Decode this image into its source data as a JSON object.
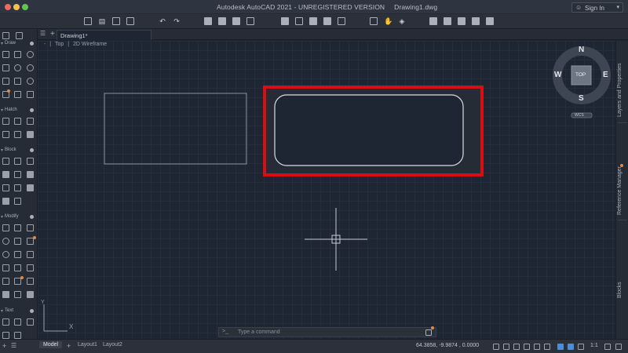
{
  "window": {
    "app_title": "Autodesk AutoCAD 2021 - UNREGISTERED VERSION",
    "file_name": "Drawing1.dwg",
    "signin_label": "Sign In"
  },
  "toolbar": {
    "icons": [
      "new-file-icon",
      "open-file-icon",
      "save-icon",
      "save-as-icon",
      "undo-icon",
      "redo-icon",
      "plot-icon",
      "plot-preview-icon",
      "publish-icon",
      "batch-plot-icon",
      "sheet-icon",
      "layer-icon",
      "match-icon",
      "copy-clip-icon",
      "view-icon",
      "pan-icon",
      "orbit-icon",
      "layer-state-icon",
      "layer-isolate-icon",
      "layer-off-icon",
      "layer-freeze-icon",
      "layer-lock-icon",
      "layer-match-icon",
      "layer-prev-icon"
    ]
  },
  "tabs": {
    "drawing_tab": "Drawing1*"
  },
  "viewport": {
    "view": "Top",
    "visual_style": "2D Wireframe",
    "separator": "|",
    "minus": "-"
  },
  "palette": {
    "sections": [
      "Draw",
      "Hatch",
      "Block",
      "Modify",
      "Text"
    ]
  },
  "viewcube": {
    "north": "N",
    "south": "S",
    "east": "E",
    "west": "W",
    "face": "TOP",
    "wcs": "WCS"
  },
  "side_panels": [
    "Layers and Properties",
    "Reference Manager",
    "Blocks"
  ],
  "ucs": {
    "y": "Y",
    "x": "X"
  },
  "command_line": {
    "placeholder": "Type a command",
    "prefix": ">_"
  },
  "status_bar": {
    "tabs": [
      "Model",
      "Layout1",
      "Layout2"
    ],
    "add": "+",
    "coordinates": "64.3858, -9.9874 , 0.0000",
    "scale": "1:1"
  },
  "colors": {
    "canvas_bg": "#1e2533",
    "highlight": "#d80f10",
    "accent": "#4a8fd6"
  }
}
